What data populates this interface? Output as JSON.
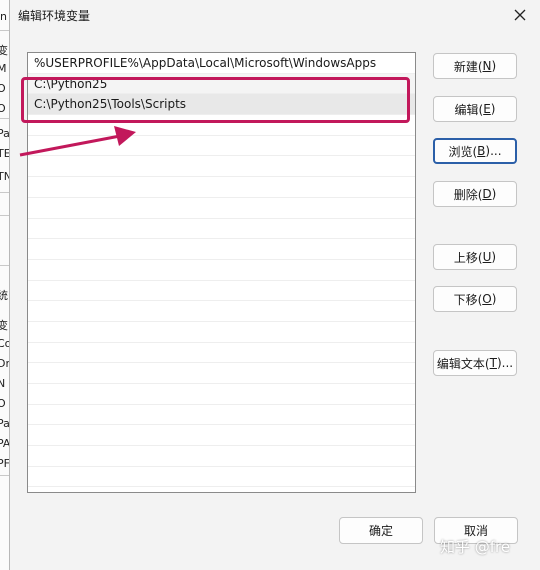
{
  "window": {
    "title": "编辑环境变量"
  },
  "background_window": {
    "fragments": [
      "in",
      "变",
      "M",
      "O",
      "O",
      "Pa",
      "TE",
      "TN",
      "统",
      "变",
      "Co",
      "Dr",
      "N",
      "O",
      "Pa",
      "PA",
      "PF"
    ]
  },
  "path_list": {
    "items": [
      {
        "text": "%USERPROFILE%\\AppData\\Local\\Microsoft\\WindowsApps",
        "state": "normal"
      },
      {
        "text": "C:\\Python25",
        "state": "hover"
      },
      {
        "text": "C:\\Python25\\Tools\\Scripts",
        "state": "selected"
      },
      {
        "text": "",
        "state": "empty"
      },
      {
        "text": "",
        "state": "empty"
      },
      {
        "text": "",
        "state": "empty"
      },
      {
        "text": "",
        "state": "empty"
      },
      {
        "text": "",
        "state": "empty"
      },
      {
        "text": "",
        "state": "empty"
      },
      {
        "text": "",
        "state": "empty"
      },
      {
        "text": "",
        "state": "empty"
      },
      {
        "text": "",
        "state": "empty"
      },
      {
        "text": "",
        "state": "empty"
      },
      {
        "text": "",
        "state": "empty"
      },
      {
        "text": "",
        "state": "empty"
      },
      {
        "text": "",
        "state": "empty"
      },
      {
        "text": "",
        "state": "empty"
      },
      {
        "text": "",
        "state": "empty"
      },
      {
        "text": "",
        "state": "empty"
      },
      {
        "text": "",
        "state": "empty"
      },
      {
        "text": "",
        "state": "empty"
      }
    ]
  },
  "buttons": {
    "new": {
      "label": "新建(",
      "key": "N",
      "tail": ")"
    },
    "edit": {
      "label": "编辑(",
      "key": "E",
      "tail": ")"
    },
    "browse": {
      "label": "浏览(",
      "key": "B",
      "tail": ")..."
    },
    "delete": {
      "label": "删除(",
      "key": "D",
      "tail": ")"
    },
    "move_up": {
      "label": "上移(",
      "key": "U",
      "tail": ")"
    },
    "move_down": {
      "label": "下移(",
      "key": "O",
      "tail": ")"
    },
    "edit_text": {
      "label": "编辑文本(",
      "key": "T",
      "tail": ")..."
    },
    "ok": {
      "label": "确定"
    },
    "cancel": {
      "label": "取消"
    }
  },
  "annotation": {
    "color": "#c2185b"
  },
  "watermark": {
    "text": "知乎 @fre"
  }
}
